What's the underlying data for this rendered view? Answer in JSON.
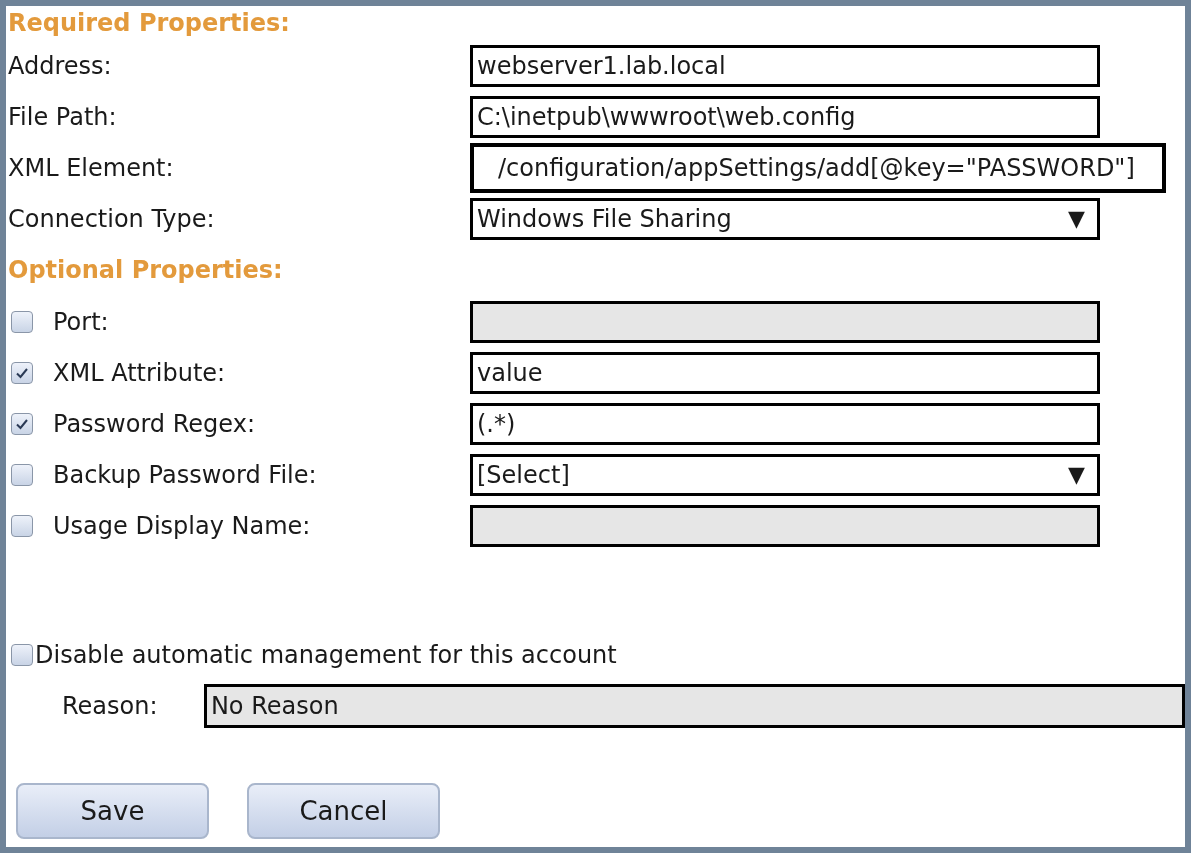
{
  "required": {
    "title": "Required Properties:",
    "fields": [
      {
        "label": "Address:",
        "kind": "text",
        "value": "webserver1.lab.local"
      },
      {
        "label": "File Path:",
        "kind": "text",
        "value": "C:\\inetpub\\wwwroot\\web.config"
      },
      {
        "label": "XML Element:",
        "kind": "text",
        "value": "/configuration/appSettings/add[@key=\"PASSWORD\"]",
        "highlighted": true
      },
      {
        "label": "Connection Type:",
        "kind": "select",
        "value": "Windows File Sharing",
        "arrow": "▼"
      }
    ]
  },
  "optional": {
    "title": "Optional Properties:",
    "fields": [
      {
        "label": "Port:",
        "checked": false,
        "kind": "text",
        "disabled": true
      },
      {
        "label": "XML Attribute:",
        "checked": true,
        "kind": "text",
        "value": "value",
        "disabled": false
      },
      {
        "label": "Password Regex:",
        "checked": true,
        "kind": "text",
        "value": "(.*)",
        "disabled": false
      },
      {
        "label": "Backup Password File:",
        "checked": false,
        "kind": "select",
        "value": "[Select]",
        "arrow": "▼",
        "disabled": false
      },
      {
        "label": "Usage Display Name:",
        "checked": false,
        "kind": "text",
        "disabled": true
      }
    ]
  },
  "disable_management": {
    "label": "Disable automatic management for this account",
    "checked": false
  },
  "reason": {
    "label": "Reason:",
    "value": "No Reason",
    "disabled": true
  },
  "buttons": [
    "Save",
    "Cancel"
  ]
}
